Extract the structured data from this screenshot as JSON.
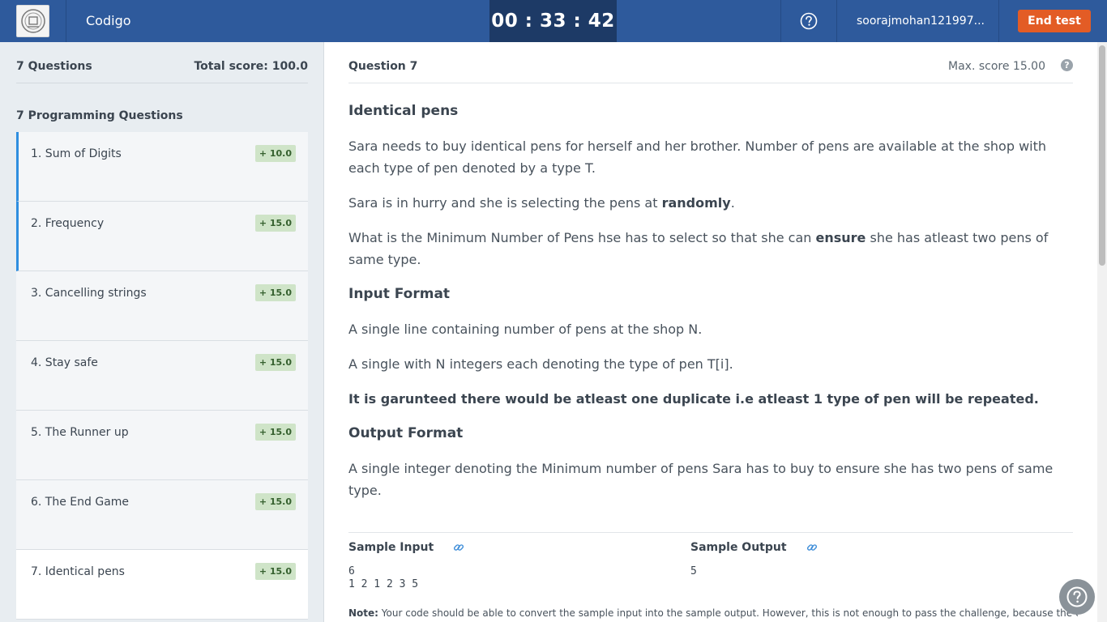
{
  "topbar": {
    "app_title": "Codigo",
    "timer": "00 : 33 : 42",
    "username": "soorajmohan121997...",
    "end_test_label": "End test"
  },
  "sidebar": {
    "question_count": "7 Questions",
    "total_score": "Total score: 100.0",
    "section_title": "7 Programming Questions",
    "questions": [
      {
        "title": "1. Sum of Digits",
        "score": "+ 10.0"
      },
      {
        "title": "2. Frequency",
        "score": "+ 15.0"
      },
      {
        "title": "3. Cancelling strings",
        "score": "+ 15.0"
      },
      {
        "title": "4. Stay safe",
        "score": "+ 15.0"
      },
      {
        "title": "5. The Runner up",
        "score": "+ 15.0"
      },
      {
        "title": "6. The End Game",
        "score": "+ 15.0"
      },
      {
        "title": "7. Identical pens",
        "score": "+ 15.0"
      }
    ]
  },
  "question": {
    "label": "Question  7",
    "max_score": "Max. score 15.00",
    "title": "Identical pens",
    "p1": "Sara needs to buy identical pens for herself and her brother. Number of pens are available at the shop with each type of pen denoted by a type T.",
    "p2_prefix": "Sara is in hurry and she is selecting the pens at ",
    "p2_bold": "randomly",
    "p2_suffix": ".",
    "p3_prefix": "What is the Minimum Number of Pens hse has to select so that she can ",
    "p3_bold": "ensure",
    "p3_suffix": " she has atleast two pens of same type.",
    "input_format_title": "Input Format",
    "input_line1": "A single line containing number of pens at the shop N.",
    "input_line2": "A single with N integers each denoting the type of pen T[i].",
    "guarantee": "It is garunteed there would be atleast one duplicate i.e atleast 1 type of pen will be repeated.",
    "output_format_title": "Output Format",
    "output_line": "A single integer denoting the Minimum number of pens Sara has to buy to ensure she has two pens of same type."
  },
  "samples": {
    "input_title": "Sample Input",
    "input_value": "6\n1 2 1 2 3 5",
    "output_title": "Sample Output",
    "output_value": "5"
  },
  "note": {
    "label": "Note:",
    "text": " Your code should be able to convert the sample input into the sample output. However, this is not enough to pass the challenge, because the code"
  },
  "colors": {
    "topbar": "#2e5a9c",
    "timer_bg": "#1d3a66",
    "end_button": "#e35c25",
    "accent": "#2f8ee0",
    "score_badge": "#cfe4c8"
  }
}
